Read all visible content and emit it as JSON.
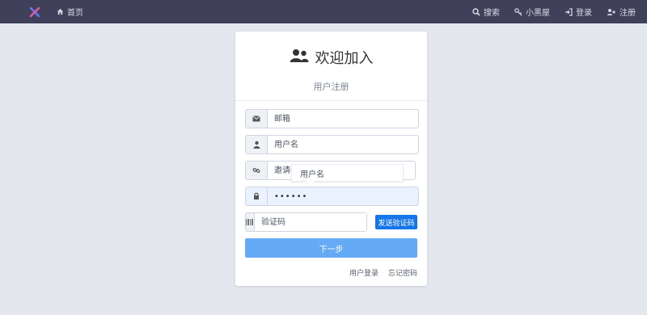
{
  "topbar": {
    "home_label": "首页",
    "search_label": "搜索",
    "blackroom_label": "小黑屋",
    "login_label": "登录",
    "register_label": "注册"
  },
  "card": {
    "title": "欢迎加入",
    "subtitle": "用户注册"
  },
  "form": {
    "email_placeholder": "邮箱",
    "username_placeholder": "用户名",
    "invite_placeholder": "邀请码",
    "password_value": "••••••",
    "captcha_placeholder": "验证码",
    "send_code_label": "发送验证码",
    "next_label": "下一步",
    "autocomplete_tooltip": "用户名"
  },
  "links": {
    "login_link": "用户登录",
    "forgot_link": "忘记密码"
  },
  "colors": {
    "topbar": "#40405a",
    "primary": "#1476e9",
    "button_light": "#65aaf4"
  }
}
